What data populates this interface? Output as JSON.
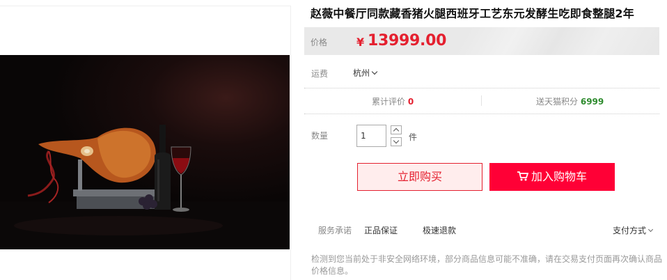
{
  "product": {
    "title": "赵薇中餐厅同款藏香猪火腿西班牙工艺东元发酵生吃即食整腿2年",
    "image_alt": "ham-with-wine-photo"
  },
  "price": {
    "label": "价格",
    "currency": "¥",
    "amount": "13999.00"
  },
  "shipping": {
    "label": "运费",
    "city": "杭州"
  },
  "stats": {
    "reviews_label": "累计评价",
    "reviews_count": "0",
    "points_label": "送天猫积分",
    "points_value": "6999"
  },
  "quantity": {
    "label": "数量",
    "value": "1",
    "unit": "件"
  },
  "actions": {
    "buy_now": "立即购买",
    "add_to_cart": "加入购物车"
  },
  "service": {
    "label": "服务承诺",
    "items": [
      "正品保证",
      "极速退款"
    ],
    "payment_label": "支付方式"
  },
  "notice": "检测到您当前处于非安全网络环境，部分商品信息可能不准确，请在交易支付页面再次确认商品价格信息。",
  "colors": {
    "price_red": "#e4202f",
    "cart_button": "#ff0036",
    "points_green": "#2e8b2e"
  }
}
